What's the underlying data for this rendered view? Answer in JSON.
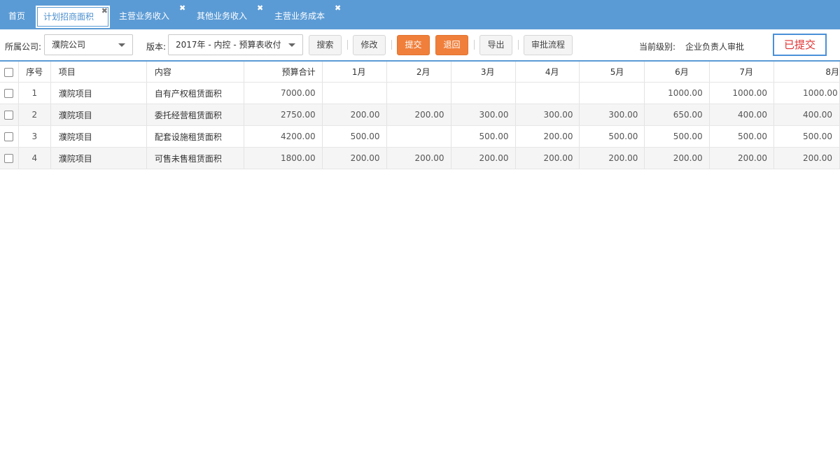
{
  "tabs": [
    {
      "label": "首页",
      "closable": false,
      "active": false
    },
    {
      "label": "计划招商面积",
      "closable": true,
      "active": true
    },
    {
      "label": "主营业务收入",
      "closable": true,
      "active": false
    },
    {
      "label": "其他业务收入",
      "closable": true,
      "active": false
    },
    {
      "label": "主营业务成本",
      "closable": true,
      "active": false
    }
  ],
  "close_glyph": "✖",
  "toolbar": {
    "company_label": "所属公司:",
    "company_value": "濮院公司",
    "version_label": "版本:",
    "version_value": "2017年 - 内控 - 预算表收付",
    "search_label": "搜索",
    "edit_label": "修改",
    "submit_label": "提交",
    "return_label": "退回",
    "export_label": "导出",
    "flow_label": "审批流程",
    "level_label": "当前级别:",
    "level_value": "企业负责人审批",
    "status_text": "已提交"
  },
  "colors": {
    "tabbar": "#5b9bd5",
    "accent_orange": "#f07f3b",
    "status_red": "#e03030",
    "status_border": "#4a90d9"
  },
  "table": {
    "headers": [
      "序号",
      "项目",
      "内容",
      "预算合计",
      "1月",
      "2月",
      "3月",
      "4月",
      "5月",
      "6月",
      "7月",
      "8月"
    ],
    "rows": [
      [
        "1",
        "濮院项目",
        "自有产权租赁面积",
        "7000.00",
        "",
        "",
        "",
        "",
        "",
        "1000.00",
        "1000.00",
        "1000.00"
      ],
      [
        "2",
        "濮院项目",
        "委托经营租赁面积",
        "2750.00",
        "200.00",
        "200.00",
        "300.00",
        "300.00",
        "300.00",
        "650.00",
        "400.00",
        "400.00"
      ],
      [
        "3",
        "濮院项目",
        "配套设施租赁面积",
        "4200.00",
        "500.00",
        "",
        "500.00",
        "200.00",
        "500.00",
        "500.00",
        "500.00",
        "500.00"
      ],
      [
        "4",
        "濮院项目",
        "可售未售租赁面积",
        "1800.00",
        "200.00",
        "200.00",
        "200.00",
        "200.00",
        "200.00",
        "200.00",
        "200.00",
        "200.00"
      ]
    ]
  }
}
